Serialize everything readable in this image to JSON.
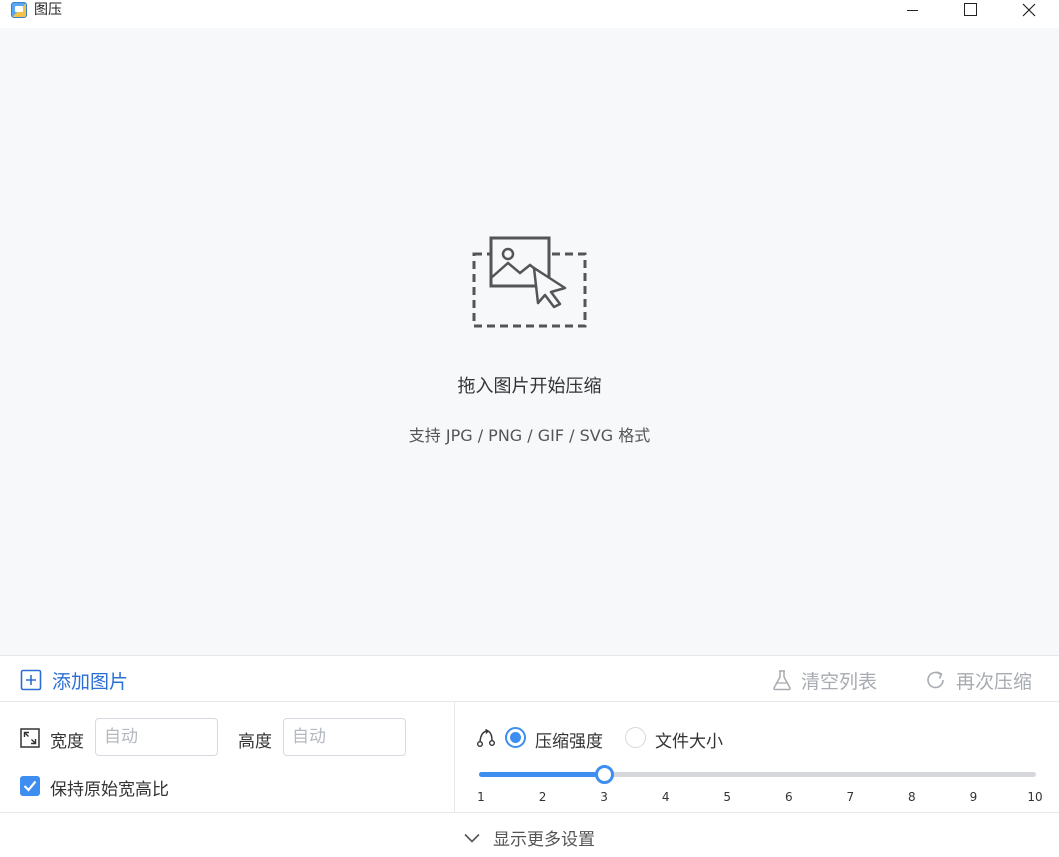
{
  "window": {
    "title": "图压",
    "minimize_icon": "minimize-icon",
    "maximize_icon": "maximize-icon",
    "close_icon": "close-icon"
  },
  "dropzone": {
    "icon": "image-drop-icon",
    "title": "拖入图片开始压缩",
    "subtitle": "支持 JPG / PNG / GIF / SVG 格式"
  },
  "toolbar": {
    "add_label": "添加图片",
    "clear_label": "清空列表",
    "recompress_label": "再次压缩",
    "accent_color": "#2a6fd6",
    "disabled_color": "#a8abb1"
  },
  "settings": {
    "width_label": "宽度",
    "width_placeholder": "自动",
    "height_label": "高度",
    "height_placeholder": "自动",
    "keep_ratio_label": "保持原始宽高比",
    "keep_ratio_checked": true,
    "mode_strength_label": "压缩强度",
    "mode_size_label": "文件大小",
    "selected_mode": "压缩强度",
    "slider": {
      "min": 1,
      "max": 10,
      "value": 3,
      "ticks": [
        "1",
        "2",
        "3",
        "4",
        "5",
        "6",
        "7",
        "8",
        "9",
        "10"
      ]
    },
    "accent_color": "#3e8df0"
  },
  "more_settings": {
    "label": "显示更多设置",
    "icon": "chevron-down-icon"
  }
}
